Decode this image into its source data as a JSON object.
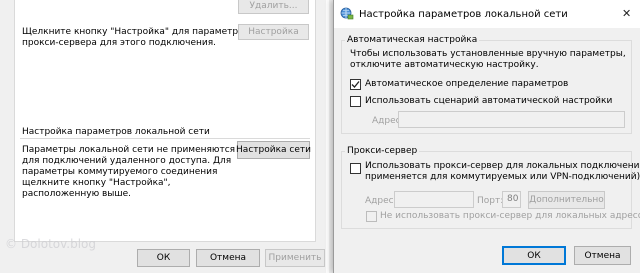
{
  "background_dialog": {
    "delete_button_label": "Удалить...",
    "proxy_hint_line1": "Щелкните кнопку \"Настройка\" для параметры",
    "proxy_hint_line2": "прокси-сервера для этого подключения.",
    "settings_button_label": "Настройка",
    "lan_section_title": "Настройка параметров локальной сети",
    "lan_info_lines": [
      "Параметры локальной сети не применяются",
      "для подключений удаленного доступа. Для",
      "параметры коммутируемого соединения",
      "щелкните кнопку \"Настройка\",",
      "расположенную выше."
    ],
    "lan_settings_button_label": "Настройка сети",
    "ok_label": "ОК",
    "cancel_label": "Отмена",
    "apply_label": "Применить"
  },
  "watermark": "© Dolotov.blog",
  "lan_dialog": {
    "title": "Настройка параметров локальной сети",
    "close_glyph": "✕",
    "auto_config": {
      "legend": "Автоматическая настройка",
      "description_line1": "Чтобы использовать установленные вручную параметры,",
      "description_line2": "отключите автоматическую настройку.",
      "auto_detect_label": "Автоматическое определение параметров",
      "auto_detect_checked": true,
      "use_script_label": "Использовать сценарий автоматической настройки",
      "use_script_checked": false,
      "address_label": "Адрес",
      "address_value": ""
    },
    "proxy": {
      "legend": "Прокси-сервер",
      "use_proxy_label_line1": "Использовать прокси-сервер для локальных подключений (не",
      "use_proxy_label_line2": "применяется для коммутируемых или VPN-подключений).",
      "use_proxy_checked": false,
      "address_label": "Адрес:",
      "address_value": "",
      "port_label": "Порт:",
      "port_value": "80",
      "advanced_label": "Дополнительно",
      "bypass_local_label": "Не использовать прокси-сервер для локальных адресов",
      "bypass_local_checked": false
    },
    "ok_label": "ОК",
    "cancel_label": "Отмена"
  }
}
